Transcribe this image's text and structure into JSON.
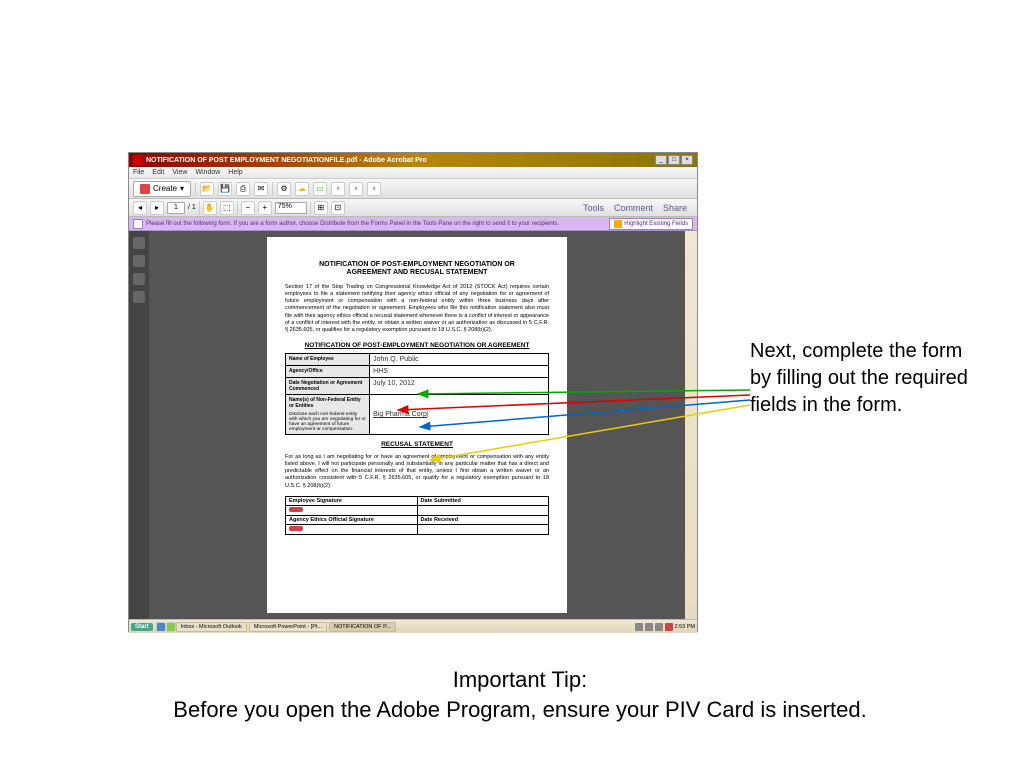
{
  "window": {
    "title": "NOTIFICATION OF POST EMPLOYMENT NEGOTIATIONFILE.pdf - Adobe Acrobat Pro"
  },
  "menubar": [
    "File",
    "Edit",
    "View",
    "Window",
    "Help"
  ],
  "toolbar": {
    "create": "Create",
    "page_current": "1",
    "page_total": "/ 1",
    "zoom": "75%",
    "actions": {
      "tools": "Tools",
      "comment": "Comment",
      "share": "Share"
    }
  },
  "formbar": {
    "message": "Please fill out the following form. If you are a form author, choose Distribute from the Forms Panel in the Tools Pane on the right to send it to your recipients.",
    "highlight": "Highlight Existing Fields"
  },
  "doc": {
    "title1": "NOTIFICATION OF POST-EMPLOYMENT NEGOTIATION OR",
    "title2": "AGREEMENT AND RECUSAL STATEMENT",
    "intro": "Section 17 of the Stop Trading on Congressional Knowledge Act of 2012 (STOCK Act) requires certain employees to file a statement notifying their agency ethics official of any negotiation for or agreement of future employment or compensation with a non-federal entity within three business days after commencement of the negotiation or agreement. Employees who file this notification statement also must file with their agency ethics official a recusal statement whenever there is a conflict of interest or appearance of a conflict of interest with the entity, or obtain a written waiver or an authorization as discussed in 5 C.F.R. § 2635.605, or qualifies for a regulatory exemption pursuant to 18 U.S.C. § 208(b)(2).",
    "section1": "NOTIFICATION OF POST-EMPLOYMENT NEGOTIATION OR AGREEMENT",
    "fields": {
      "name_label": "Name of Employee",
      "name_value": "John Q. Public",
      "agency_label": "Agency/Office",
      "agency_value": "HHS",
      "date_label": "Date Negotiation or Agreement Commenced",
      "date_value": "July 10, 2012",
      "entity_label": "Name(s) of Non-Federal Entity or Entities",
      "entity_desc": "Disclose each non-federal entity with which you are negotiating for or have an agreement of future employment or compensation.",
      "entity_value": "Big Pharma Corp"
    },
    "section2": "RECUSAL STATEMENT",
    "recusal": "For as long as I am negotiating for or have an agreement of employment or compensation with any entity listed above, I will not participate personally and substantially in any particular matter that has a direct and predictable effect on the financial interests of that entity, unless I first obtain a written waiver or an authorization consistent with 5 C.F.R. § 2635.605, or qualify for a regulatory exemption pursuant to 18 U.S.C. § 208(b)(2).",
    "sig": {
      "emp_sig": "Employee Signature",
      "date_sub": "Date Submitted",
      "ethics_sig": "Agency Ethics Official Signature",
      "date_rec": "Date Received"
    }
  },
  "taskbar": {
    "start": "Start",
    "items": [
      "Inbox - Microsoft Outlook",
      "Microsoft PowerPoint - [Pt...",
      "NOTIFICATION OF P..."
    ],
    "time": "2:53 PM"
  },
  "annotation": "Next, complete the form by filling out the required fields in the form.",
  "tip": {
    "title": "Important Tip:",
    "text": "Before you open the Adobe Program, ensure your PIV Card is inserted."
  }
}
